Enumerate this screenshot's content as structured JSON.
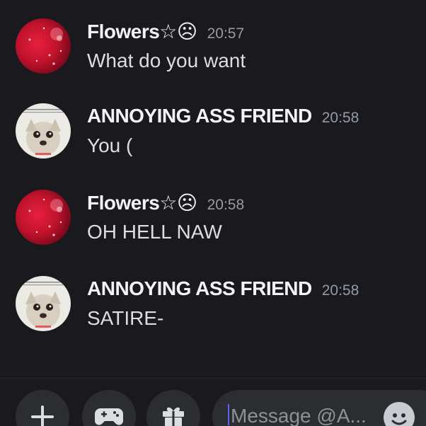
{
  "messages": [
    {
      "author": "Flowers☆☹",
      "time": "20:57",
      "text": "What do you want",
      "avatar_icon": "red-sparkle-avatar"
    },
    {
      "author": "ANNOYING ASS FRIEND",
      "time": "20:58",
      "text": "You (",
      "avatar_icon": "chihuahua-meme-avatar"
    },
    {
      "author": "Flowers☆☹",
      "time": "20:58",
      "text": "OH HELL NAW",
      "avatar_icon": "red-sparkle-avatar"
    },
    {
      "author": "ANNOYING ASS FRIEND",
      "time": "20:58",
      "text": "SATIRE-",
      "avatar_icon": "chihuahua-meme-avatar"
    }
  ],
  "composer": {
    "placeholder": "Message @A...",
    "buttons": [
      "plus-icon",
      "gamepad-icon",
      "gift-icon",
      "emoji-icon"
    ]
  },
  "colors": {
    "background": "#1a1a1e",
    "button_bg": "#2b2d31",
    "username": "#f2f3f5",
    "timestamp": "#949ba4",
    "message_text": "#dbdee1",
    "caret": "#5865f2"
  }
}
